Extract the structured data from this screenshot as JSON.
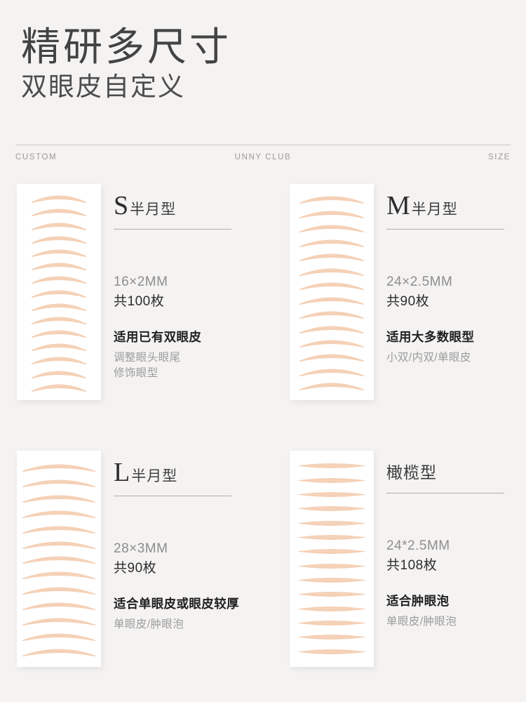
{
  "hero": {
    "title": "精研多尺寸",
    "subtitle": "双眼皮自定义"
  },
  "labelbar": {
    "left": "CUSTOM",
    "center": "UNNY CLUB",
    "right": "SIZE"
  },
  "theme": {
    "page_background": "#f4f3f2",
    "sheet_background": "#ffffff",
    "tape_color": "#f3c6a6",
    "tape_color_light": "#f8ddc9",
    "divider_color": "#adadad",
    "text_dark": "#212121",
    "text_mid": "#8d8d8d",
    "text_light": "#9c9c9c"
  },
  "cards": [
    {
      "letter": "S",
      "title_cn": "半月型",
      "size": "16×2MM",
      "count": "共100枚",
      "usage_main": "适用已有双眼皮",
      "usage_sub_1": "调整眼头眼尾",
      "usage_sub_2": "修饰眼型",
      "strip_shape": "crescent",
      "strip_count": 15,
      "strip_width": 78
    },
    {
      "letter": "M",
      "title_cn": "半月型",
      "size": "24×2.5MM",
      "count": "共90枚",
      "usage_main": "适用大多数眼型",
      "usage_sub_1": "小双/内双/单眼皮",
      "usage_sub_2": "",
      "strip_shape": "crescent",
      "strip_count": 14,
      "strip_width": 92
    },
    {
      "letter": "L",
      "title_cn": "半月型",
      "size": "28×3MM",
      "count": "共90枚",
      "usage_main": "适合单眼皮或眼皮较厚",
      "usage_sub_1": "单眼皮/肿眼泡",
      "usage_sub_2": "",
      "strip_shape": "crescent",
      "strip_count": 13,
      "strip_width": 104
    },
    {
      "letter": "",
      "title_cn": "橄榄型",
      "size": "24*2.5MM",
      "count": "共108枚",
      "usage_main": "适合肿眼泡",
      "usage_sub_1": "单眼皮/肿眼泡",
      "usage_sub_2": "",
      "strip_shape": "olive",
      "strip_count": 14,
      "strip_width": 96
    }
  ]
}
